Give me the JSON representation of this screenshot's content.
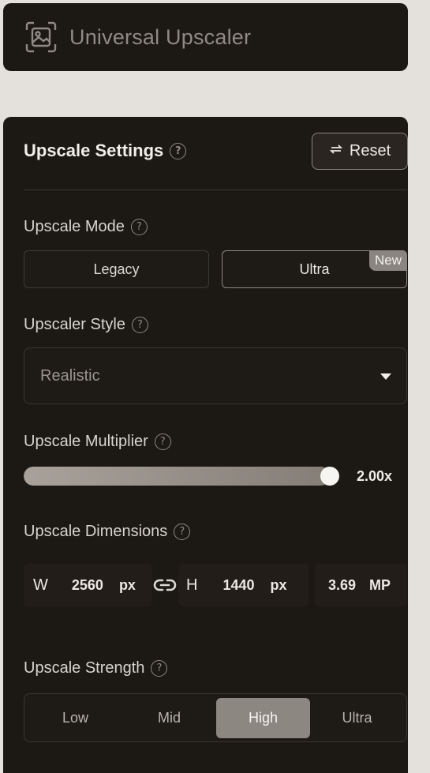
{
  "app": {
    "title": "Universal Upscaler",
    "logo_icon": "image-frame-icon"
  },
  "settings": {
    "title": "Upscale Settings",
    "reset_label": "Reset",
    "reset_icon": "swap-arrows-icon",
    "mode": {
      "label": "Upscale Mode",
      "options": [
        "Legacy",
        "Ultra"
      ],
      "selected": "Ultra",
      "badge": "New"
    },
    "style": {
      "label": "Upscaler Style",
      "value": "Realistic"
    },
    "multiplier": {
      "label": "Upscale Multiplier",
      "value_text": "2.00x",
      "fill_fraction": 0.97
    },
    "dimensions": {
      "label": "Upscale Dimensions",
      "width_key": "W",
      "width": "2560",
      "width_unit": "px",
      "height_key": "H",
      "height": "1440",
      "height_unit": "px",
      "megapixels": "3.69",
      "mp_unit": "MP"
    },
    "strength": {
      "label": "Upscale Strength",
      "options": [
        "Low",
        "Mid",
        "High",
        "Ultra"
      ],
      "selected": "High"
    }
  },
  "colors": {
    "panel_bg": "#1c1814",
    "page_bg": "#e4e0db",
    "accent": "#8d8782"
  }
}
